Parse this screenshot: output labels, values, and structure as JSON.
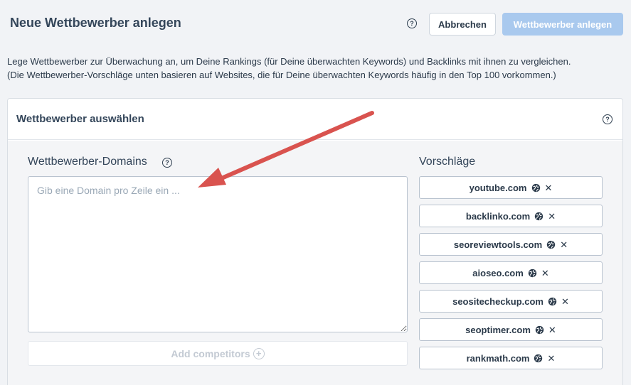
{
  "header": {
    "title": "Neue Wettbewerber anlegen",
    "help": "?",
    "cancel_label": "Abbrechen",
    "create_label": "Wettbewerber anlegen"
  },
  "intro": {
    "line1": "Lege Wettbewerber zur Überwachung an, um Deine Rankings (für Deine überwachten Keywords) und Backlinks mit ihnen zu vergleichen.",
    "line2": "(Die Wettbewerber-Vorschläge unten basieren auf Websites, die für Deine überwachten Keywords häufig in den Top 100 vorkommen.)"
  },
  "panel": {
    "title": "Wettbewerber auswählen",
    "help": "?",
    "domains_label": "Wettbewerber-Domains",
    "domains_help": "?",
    "domains_placeholder": "Gib eine Domain pro Zeile ein ...",
    "domains_value": "",
    "add_label": "Add competitors",
    "add_icon": "+",
    "suggestions_label": "Vorschläge",
    "suggestions": [
      {
        "domain": "youtube.com",
        "remove": "✕"
      },
      {
        "domain": "backlinko.com",
        "remove": "✕"
      },
      {
        "domain": "seoreviewtools.com",
        "remove": "✕"
      },
      {
        "domain": "aioseo.com",
        "remove": "✕"
      },
      {
        "domain": "seositecheckup.com",
        "remove": "✕"
      },
      {
        "domain": "seoptimer.com",
        "remove": "✕"
      },
      {
        "domain": "rankmath.com",
        "remove": "✕"
      }
    ]
  },
  "colors": {
    "primary_disabled": "#a9c9ee",
    "arrow": "#d9534f"
  }
}
